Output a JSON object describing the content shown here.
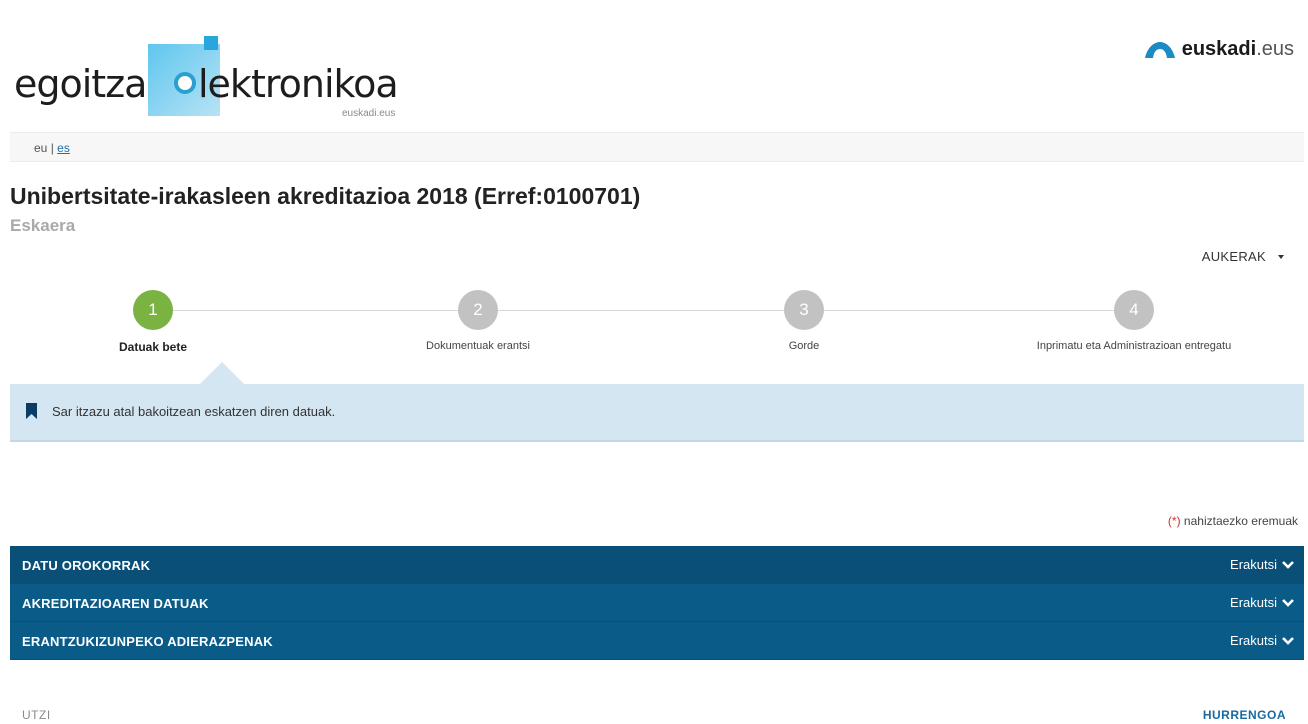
{
  "header": {
    "logo": {
      "word1": "egoitza",
      "word2": "lektronikoa",
      "sub": "euskadi.eus"
    },
    "brand": {
      "bold": "euskadi",
      "rest": ".eus"
    }
  },
  "lang": {
    "current": "eu",
    "separator": "|",
    "other": "es"
  },
  "page": {
    "title": "Unibertsitate-irakasleen akreditazioa 2018 (Erref:0100701)",
    "subtitle": "Eskaera"
  },
  "options": {
    "label": "AUKERAK"
  },
  "steps": [
    {
      "number": "1",
      "label": "Datuak bete",
      "active": true
    },
    {
      "number": "2",
      "label": "Dokumentuak erantsi",
      "active": false
    },
    {
      "number": "3",
      "label": "Gorde",
      "active": false
    },
    {
      "number": "4",
      "label": "Inprimatu eta Administrazioan entregatu",
      "active": false
    }
  ],
  "info": {
    "text": "Sar itzazu atal bakoitzean eskatzen diren datuak."
  },
  "required_note": {
    "star": "(*)",
    "text": "nahiztaezko eremuak"
  },
  "sections": [
    {
      "title": "DATU OROKORRAK",
      "toggle": "Erakutsi"
    },
    {
      "title": "AKREDITAZIOAREN DATUAK",
      "toggle": "Erakutsi"
    },
    {
      "title": "ERANTZUKIZUNPEKO ADIERAZPENAK",
      "toggle": "Erakutsi"
    }
  ],
  "actions": {
    "cancel": "UTZI",
    "next": "HURRENGOA"
  },
  "colors": {
    "primary": "#0b5b89",
    "active_step": "#7bb342",
    "info_bg": "#d4e6f2"
  }
}
